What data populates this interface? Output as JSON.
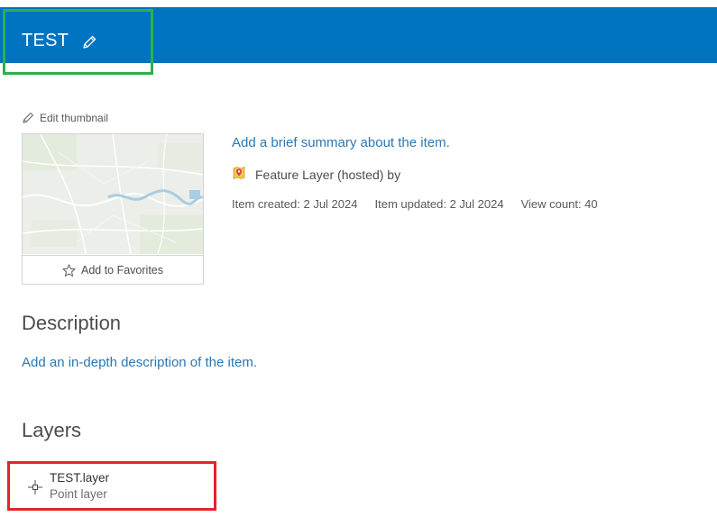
{
  "header": {
    "title": "TEST",
    "edit_icon": "pencil-icon",
    "background_color": "#0074c0"
  },
  "thumbnail": {
    "edit_label": "Edit thumbnail",
    "favorites_label": "Add to Favorites",
    "favorites_icon": "star-outline-icon"
  },
  "summary": {
    "link_text": "Add a brief summary about the item.",
    "type_icon": "feature-layer-icon",
    "type_text": "Feature Layer (hosted) by",
    "created": "Item created: 2 Jul 2024",
    "updated": "Item updated: 2 Jul 2024",
    "views": "View count: 40"
  },
  "description": {
    "heading": "Description",
    "link_text": "Add an in-depth description of the item."
  },
  "layers": {
    "heading": "Layers",
    "items": [
      {
        "name": "TEST.layer",
        "type": "Point layer",
        "icon": "point-layer-icon"
      }
    ]
  },
  "colors": {
    "link": "#2d77b3",
    "highlight_green": "#2db04a",
    "highlight_red": "#e0262c"
  }
}
